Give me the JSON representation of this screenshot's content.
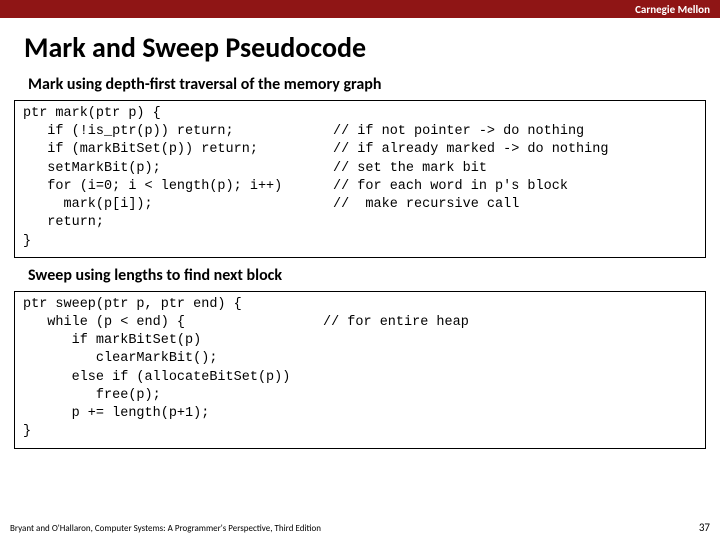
{
  "header": {
    "org": "Carnegie Mellon"
  },
  "title": "Mark and Sweep Pseudocode",
  "sections": {
    "mark": {
      "heading": "Mark using depth-first traversal of the memory graph",
      "lines": [
        {
          "code": "ptr mark(ptr p) {",
          "comment": ""
        },
        {
          "code": "   if (!is_ptr(p)) return;",
          "comment": "// if not pointer -> do nothing"
        },
        {
          "code": "   if (markBitSet(p)) return;",
          "comment": "// if already marked -> do nothing"
        },
        {
          "code": "   setMarkBit(p);",
          "comment": "// set the mark bit"
        },
        {
          "code": "   for (i=0; i < length(p); i++)",
          "comment": "// for each word in p's block"
        },
        {
          "code": "     mark(p[i]);",
          "comment": "//  make recursive call"
        },
        {
          "code": "   return;",
          "comment": ""
        },
        {
          "code": "}",
          "comment": ""
        }
      ]
    },
    "sweep": {
      "heading": "Sweep using lengths to find next block",
      "lines": [
        {
          "code": "ptr sweep(ptr p, ptr end) {",
          "comment": ""
        },
        {
          "code": "   while (p < end) {",
          "comment": "// for entire heap"
        },
        {
          "code": "      if markBitSet(p)",
          "comment": ""
        },
        {
          "code": "         clearMarkBit();",
          "comment": ""
        },
        {
          "code": "      else if (allocateBitSet(p))",
          "comment": ""
        },
        {
          "code": "         free(p);",
          "comment": ""
        },
        {
          "code": "      p += length(p+1);",
          "comment": ""
        },
        {
          "code": "}",
          "comment": ""
        }
      ]
    }
  },
  "footer": {
    "citation": "Bryant and O'Hallaron, Computer Systems: A Programmer's Perspective, Third Edition",
    "pageno": "37"
  }
}
